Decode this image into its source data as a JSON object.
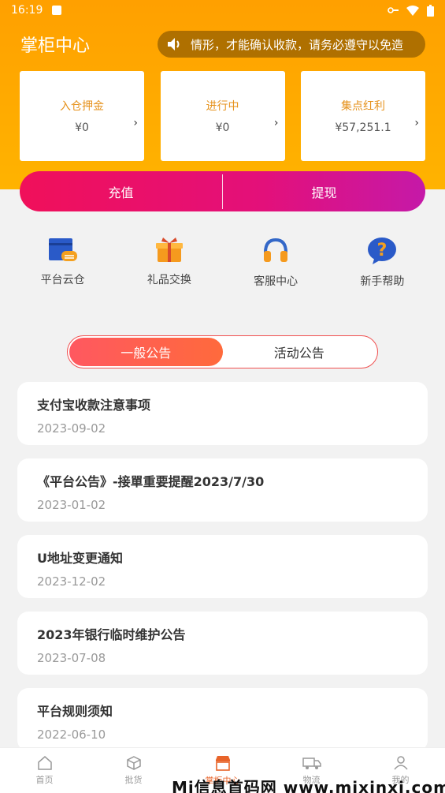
{
  "status_bar": {
    "time": "16:19"
  },
  "header": {
    "title": "掌柜中心",
    "marquee_text": "情形，才能确认收款，请务必遵守以免造"
  },
  "cards": [
    {
      "label": "入仓押金",
      "value": "¥0"
    },
    {
      "label": "进行中",
      "value": "¥0"
    },
    {
      "label": "集点红利",
      "value": "¥57,251.1"
    }
  ],
  "actions": {
    "recharge": "充值",
    "withdraw": "提现"
  },
  "quick_links": [
    {
      "label": "平台云仓",
      "icon": "warehouse-icon"
    },
    {
      "label": "礼品交换",
      "icon": "gift-icon"
    },
    {
      "label": "客服中心",
      "icon": "headset-icon"
    },
    {
      "label": "新手帮助",
      "icon": "help-icon"
    }
  ],
  "tabs": {
    "general": "一般公告",
    "activity": "活动公告"
  },
  "notices": [
    {
      "title": "支付宝收款注意事项",
      "date": "2023-09-02"
    },
    {
      "title": "《平台公告》-接單重要提醒2023/7/30",
      "date": "2023-01-02"
    },
    {
      "title": "U地址变更通知",
      "date": "2023-12-02"
    },
    {
      "title": "2023年银行临时维护公告",
      "date": "2023-07-08"
    },
    {
      "title": "平台规则须知",
      "date": "2022-06-10"
    }
  ],
  "bottom_nav": [
    {
      "label": "首页"
    },
    {
      "label": "批货"
    },
    {
      "label": "掌柜中心"
    },
    {
      "label": "物流"
    },
    {
      "label": "我的"
    }
  ],
  "watermark": "Mi信息首码网 www.mixinxi.com",
  "colors": {
    "primary_orange": "#ffa000",
    "accent_pink": "#f0105a",
    "active_tab": "#ff5860"
  }
}
